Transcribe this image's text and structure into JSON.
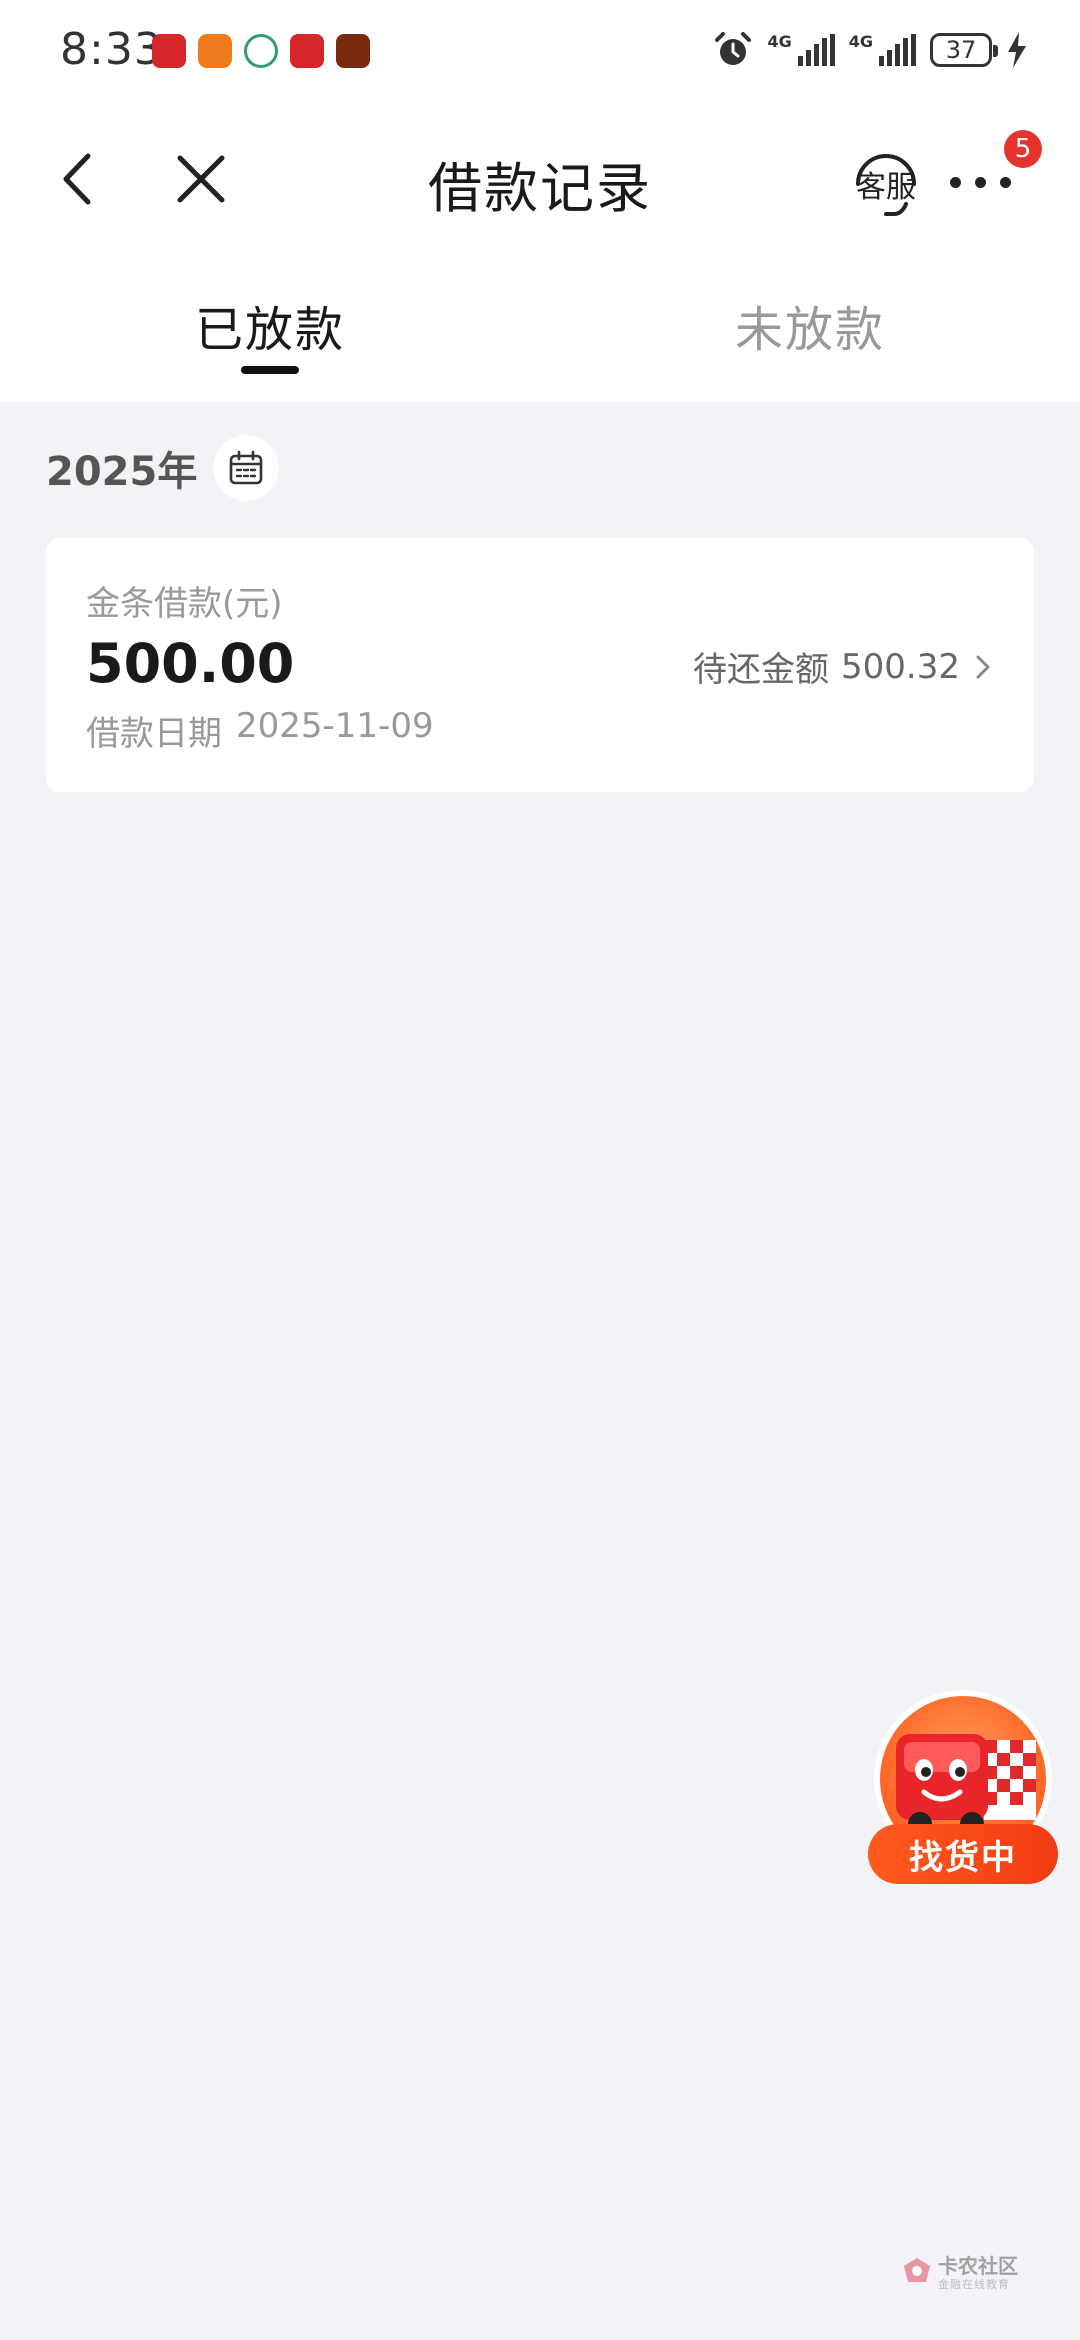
{
  "status_bar": {
    "time": "8:33",
    "network_1": "4G",
    "network_2": "4G",
    "battery": "37",
    "notification_icons": [
      "app-icon-red",
      "app-icon-orange",
      "app-icon-green",
      "app-icon-red",
      "app-icon-game"
    ]
  },
  "nav": {
    "title": "借款记录",
    "service_label": "客服",
    "more_badge": "5",
    "back_icon": "chevron-left-icon",
    "close_icon": "close-icon",
    "more_icon": "more-dots-icon"
  },
  "tabs": [
    {
      "label": "已放款",
      "active": true
    },
    {
      "label": "未放款",
      "active": false
    }
  ],
  "year": {
    "label": "2025年",
    "calendar_icon": "calendar-icon"
  },
  "loan_card": {
    "type_label": "金条借款(元)",
    "amount": "500.00",
    "date_label": "借款日期",
    "date_value": "2025-11-09",
    "due_label": "待还金额",
    "due_value": "500.32"
  },
  "floating_widget": {
    "label": "找货中"
  },
  "watermark": {
    "title": "卡农社区",
    "subtitle": "金融在线教育"
  },
  "colors": {
    "background": "#f2f2f7",
    "accent": "#e8332d",
    "widget": "#f23b13",
    "text_primary": "#1a1a1a",
    "text_secondary": "#999999"
  }
}
